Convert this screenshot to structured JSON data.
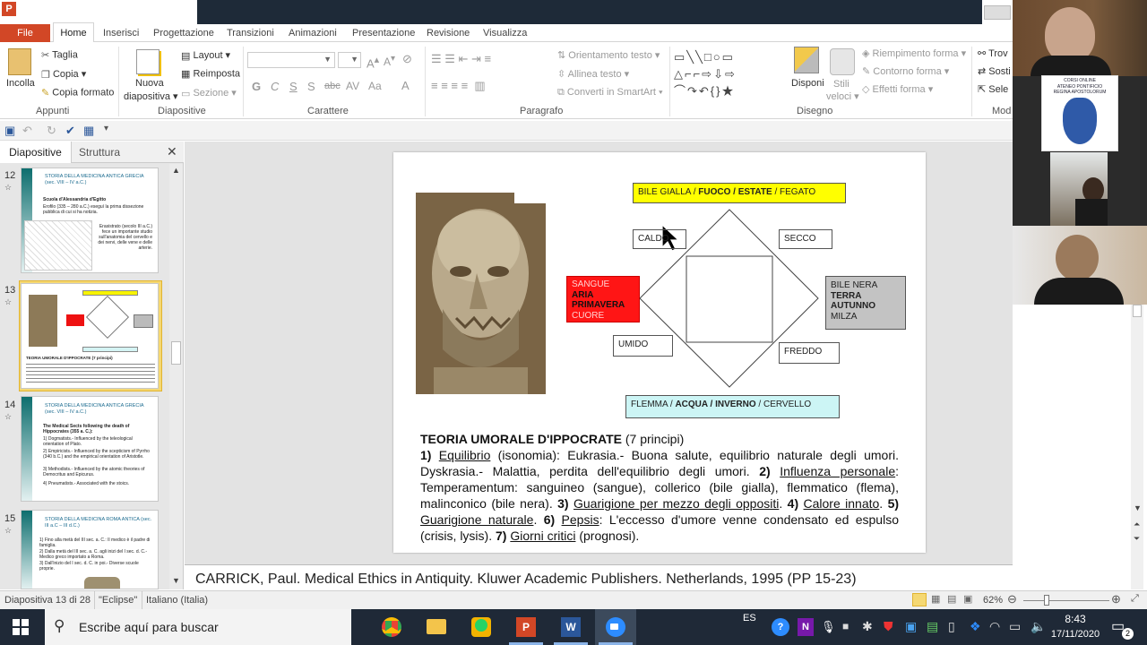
{
  "app": {
    "icon_letter": "P"
  },
  "tabs": {
    "file": "File",
    "items": [
      "Home",
      "Inserisci",
      "Progettazione",
      "Transizioni",
      "Animazioni",
      "Presentazione",
      "Revisione",
      "Visualizza"
    ]
  },
  "ribbon": {
    "appunti": {
      "label": "Appunti",
      "incolla": "Incolla",
      "taglia": "Taglia",
      "copia": "Copia",
      "copia_formato": "Copia formato"
    },
    "diapositive": {
      "label": "Diapositive",
      "nuova": "Nuova",
      "diapositiva": "diapositiva",
      "layout": "Layout",
      "reimposta": "Reimposta",
      "sezione": "Sezione"
    },
    "carattere": {
      "label": "Carattere",
      "font_value": "",
      "size_value": ""
    },
    "paragrafo": {
      "label": "Paragrafo",
      "orientamento": "Orientamento testo",
      "allinea": "Allinea testo",
      "converti": "Converti in SmartArt"
    },
    "disegno": {
      "label": "Disegno",
      "disponi": "Disponi",
      "stili": "Stili",
      "veloci": "veloci",
      "riempimento": "Riempimento forma",
      "contorno": "Contorno forma",
      "effetti": "Effetti forma"
    },
    "modifica": {
      "trova": "Trov",
      "sostituisci": "Sosti",
      "seleziona": "Sele",
      "label": "Mod"
    }
  },
  "panel": {
    "tab_diapositive": "Diapositive",
    "tab_struttura": "Struttura",
    "close": "✕"
  },
  "thumbnails": [
    {
      "num": "12",
      "title": "STORIA DELLA MEDICINA ANTICA GRECIA (sec. VIII – IV a.C.)",
      "lines": [
        "Scuola d'Alessandria d'Egitto",
        "Erofilo (335 – 280 a.C.) eseguì la prima dissezione pubblica di cui si ha notizia.",
        "Erasistrato (secolo III a.C.) fece un importante studio sull'anatomia del cervello e dei nervi, delle vene e delle arterie."
      ]
    },
    {
      "num": "13",
      "title": "",
      "lines": [
        "TEORIA UMORALE D'IPPOCRATE (7 principi)"
      ]
    },
    {
      "num": "14",
      "title": "STORIA DELLA MEDICINA ANTICA GRECIA (sec. VIII – IV a.C.)",
      "lines": [
        "The Medical Sects following the death of Hippocrates (355 a. C.):",
        "1) Dogmatists.- Influenced by the teleological orientation of Plato.",
        "2) Empiricists.- Influenced by the scepticism of Pyrrho (340 b.C.) and the empirical orientation of Aristotle.",
        "3) Methodists.- Influenced by the atomic theories of Democritus and Epicurus.",
        "4) Pneumatists.- Associated with the stoics."
      ]
    },
    {
      "num": "15",
      "title": "STORIA DELLA MEDICINA ROMA ANTICA (sec. III a.C – III d.C.)",
      "lines": [
        "1) Fino alla metà del III sec. a. C.: Il medico è il padre di famiglia.",
        "2) Dalla metà del III sec. a. C. agli inizi del I sec. d. C.- Medico greco importato a Roma.",
        "3) Dall'inizio del I sec. d. C. in poi.- Diverse scuole proprie."
      ]
    }
  ],
  "slide": {
    "top_box": {
      "pre": "BILE GIALLA / ",
      "bold": "FUOCO / ESTATE",
      "post": " / FEGATO"
    },
    "caldo": "CALDO",
    "secco": "SECCO",
    "umido": "UMIDO",
    "freddo": "FREDDO",
    "left_box": {
      "l1": "SANGUE",
      "l2": "ARIA",
      "l3": "PRIMAVERA",
      "l4": "CUORE"
    },
    "right_box": {
      "l1": "BILE  NERA",
      "l2": "TERRA",
      "l3": "AUTUNNO",
      "l4": "MILZA"
    },
    "bottom_box": {
      "pre": "FLEMMA / ",
      "bold": "ACQUA / INVERNO",
      "post": " / CERVELLO"
    },
    "heading": "TEORIA UMORALE D'IPPOCRATE",
    "heading_sub": " (7 principi)",
    "p1n": "1) ",
    "p1u": "Equilibrio",
    "p1t": " (isonomia): Eukrasia.- Buona salute, equilibrio naturale degli umori. Dyskrasia.- Malattia, perdita dell'equilibrio degli umori. ",
    "p2n": "2) ",
    "p2u": "Influenza personale",
    "p2t": ": Temperamentum: sanguineo (sangue), collerico (bile gialla), flemmatico (flema), malinconico (bile nera). ",
    "p3n": "3) ",
    "p3u": "Guarigione per mezzo degli oppositi",
    "p3t": ". ",
    "p4n": "4) ",
    "p4u": "Calore innato",
    "p4t": ". ",
    "p5n": "5) ",
    "p5u": "Guarigione naturale",
    "p5t": ". ",
    "p6n": "6) ",
    "p6u": "Pepsis",
    "p6t": ": L'eccesso d'umore venne condensato ed espulso (crisis, lysis). ",
    "p7n": "7) ",
    "p7u": "Giorni critici",
    "p7t": " (prognosi)."
  },
  "notes": "CARRICK, Paul. Medical Ethics in Antiquity. Kluwer Academic Publishers. Netherlands, 1995 (PP 15-23)",
  "status": {
    "slide": "Diapositiva 13 di 28",
    "theme": "\"Eclipse\"",
    "lang": "Italiano (Italia)",
    "zoom": "62%"
  },
  "taskbar": {
    "search": "Escribe aquí para buscar",
    "lang": "ES",
    "time": "8:43",
    "date": "17/11/2020",
    "notif": "2"
  },
  "zoom": {
    "logo_l1": "CORSI ONLINE",
    "logo_l2": "ATENEO PONTIFICIO",
    "logo_l3": "REGINA APOSTOLORUM"
  }
}
